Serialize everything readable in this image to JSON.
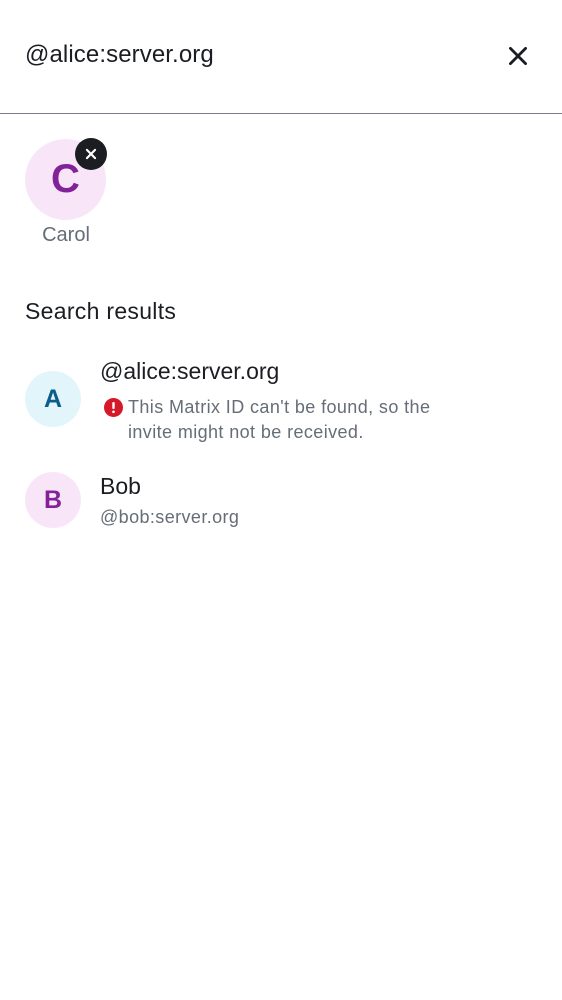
{
  "search": {
    "query": "@alice:server.org",
    "close_icon": "close-icon"
  },
  "selected_users": [
    {
      "initial": "C",
      "name": "Carol",
      "avatar_bg": "#f8e6f8",
      "avatar_fg": "#822198",
      "remove_icon": "close-icon"
    }
  ],
  "results": {
    "title": "Search results",
    "items": [
      {
        "initial": "A",
        "title": "@alice:server.org",
        "warning": "This Matrix ID can't be found, so the invite might not be received.",
        "warning_icon": "error-icon",
        "avatar_bg": "#e2f5fa",
        "avatar_fg": "#0b5e8a"
      },
      {
        "initial": "B",
        "title": "Bob",
        "subtitle": "@bob:server.org",
        "avatar_bg": "#f8e6f8",
        "avatar_fg": "#822198"
      }
    ]
  },
  "colors": {
    "error": "#d51928",
    "secondary_text": "#656d77",
    "primary_text": "#1b1d22",
    "divider": "#7d7a8a"
  }
}
